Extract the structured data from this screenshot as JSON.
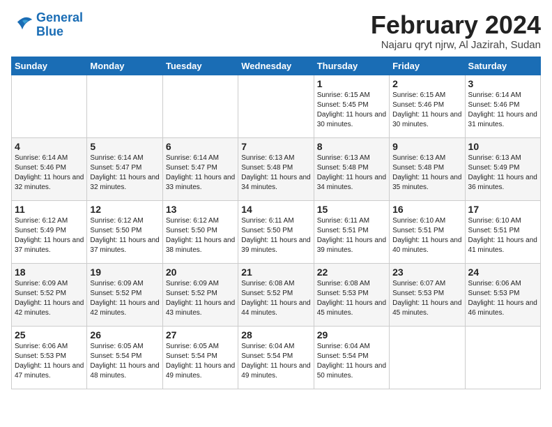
{
  "logo": {
    "line1": "General",
    "line2": "Blue"
  },
  "title": "February 2024",
  "location": "Najaru qryt njrw, Al Jazirah, Sudan",
  "days_of_week": [
    "Sunday",
    "Monday",
    "Tuesday",
    "Wednesday",
    "Thursday",
    "Friday",
    "Saturday"
  ],
  "weeks": [
    [
      {
        "day": "",
        "info": ""
      },
      {
        "day": "",
        "info": ""
      },
      {
        "day": "",
        "info": ""
      },
      {
        "day": "",
        "info": ""
      },
      {
        "day": "1",
        "info": "Sunrise: 6:15 AM\nSunset: 5:45 PM\nDaylight: 11 hours and 30 minutes."
      },
      {
        "day": "2",
        "info": "Sunrise: 6:15 AM\nSunset: 5:46 PM\nDaylight: 11 hours and 30 minutes."
      },
      {
        "day": "3",
        "info": "Sunrise: 6:14 AM\nSunset: 5:46 PM\nDaylight: 11 hours and 31 minutes."
      }
    ],
    [
      {
        "day": "4",
        "info": "Sunrise: 6:14 AM\nSunset: 5:46 PM\nDaylight: 11 hours and 32 minutes."
      },
      {
        "day": "5",
        "info": "Sunrise: 6:14 AM\nSunset: 5:47 PM\nDaylight: 11 hours and 32 minutes."
      },
      {
        "day": "6",
        "info": "Sunrise: 6:14 AM\nSunset: 5:47 PM\nDaylight: 11 hours and 33 minutes."
      },
      {
        "day": "7",
        "info": "Sunrise: 6:13 AM\nSunset: 5:48 PM\nDaylight: 11 hours and 34 minutes."
      },
      {
        "day": "8",
        "info": "Sunrise: 6:13 AM\nSunset: 5:48 PM\nDaylight: 11 hours and 34 minutes."
      },
      {
        "day": "9",
        "info": "Sunrise: 6:13 AM\nSunset: 5:48 PM\nDaylight: 11 hours and 35 minutes."
      },
      {
        "day": "10",
        "info": "Sunrise: 6:13 AM\nSunset: 5:49 PM\nDaylight: 11 hours and 36 minutes."
      }
    ],
    [
      {
        "day": "11",
        "info": "Sunrise: 6:12 AM\nSunset: 5:49 PM\nDaylight: 11 hours and 37 minutes."
      },
      {
        "day": "12",
        "info": "Sunrise: 6:12 AM\nSunset: 5:50 PM\nDaylight: 11 hours and 37 minutes."
      },
      {
        "day": "13",
        "info": "Sunrise: 6:12 AM\nSunset: 5:50 PM\nDaylight: 11 hours and 38 minutes."
      },
      {
        "day": "14",
        "info": "Sunrise: 6:11 AM\nSunset: 5:50 PM\nDaylight: 11 hours and 39 minutes."
      },
      {
        "day": "15",
        "info": "Sunrise: 6:11 AM\nSunset: 5:51 PM\nDaylight: 11 hours and 39 minutes."
      },
      {
        "day": "16",
        "info": "Sunrise: 6:10 AM\nSunset: 5:51 PM\nDaylight: 11 hours and 40 minutes."
      },
      {
        "day": "17",
        "info": "Sunrise: 6:10 AM\nSunset: 5:51 PM\nDaylight: 11 hours and 41 minutes."
      }
    ],
    [
      {
        "day": "18",
        "info": "Sunrise: 6:09 AM\nSunset: 5:52 PM\nDaylight: 11 hours and 42 minutes."
      },
      {
        "day": "19",
        "info": "Sunrise: 6:09 AM\nSunset: 5:52 PM\nDaylight: 11 hours and 42 minutes."
      },
      {
        "day": "20",
        "info": "Sunrise: 6:09 AM\nSunset: 5:52 PM\nDaylight: 11 hours and 43 minutes."
      },
      {
        "day": "21",
        "info": "Sunrise: 6:08 AM\nSunset: 5:52 PM\nDaylight: 11 hours and 44 minutes."
      },
      {
        "day": "22",
        "info": "Sunrise: 6:08 AM\nSunset: 5:53 PM\nDaylight: 11 hours and 45 minutes."
      },
      {
        "day": "23",
        "info": "Sunrise: 6:07 AM\nSunset: 5:53 PM\nDaylight: 11 hours and 45 minutes."
      },
      {
        "day": "24",
        "info": "Sunrise: 6:06 AM\nSunset: 5:53 PM\nDaylight: 11 hours and 46 minutes."
      }
    ],
    [
      {
        "day": "25",
        "info": "Sunrise: 6:06 AM\nSunset: 5:53 PM\nDaylight: 11 hours and 47 minutes."
      },
      {
        "day": "26",
        "info": "Sunrise: 6:05 AM\nSunset: 5:54 PM\nDaylight: 11 hours and 48 minutes."
      },
      {
        "day": "27",
        "info": "Sunrise: 6:05 AM\nSunset: 5:54 PM\nDaylight: 11 hours and 49 minutes."
      },
      {
        "day": "28",
        "info": "Sunrise: 6:04 AM\nSunset: 5:54 PM\nDaylight: 11 hours and 49 minutes."
      },
      {
        "day": "29",
        "info": "Sunrise: 6:04 AM\nSunset: 5:54 PM\nDaylight: 11 hours and 50 minutes."
      },
      {
        "day": "",
        "info": ""
      },
      {
        "day": "",
        "info": ""
      }
    ]
  ]
}
